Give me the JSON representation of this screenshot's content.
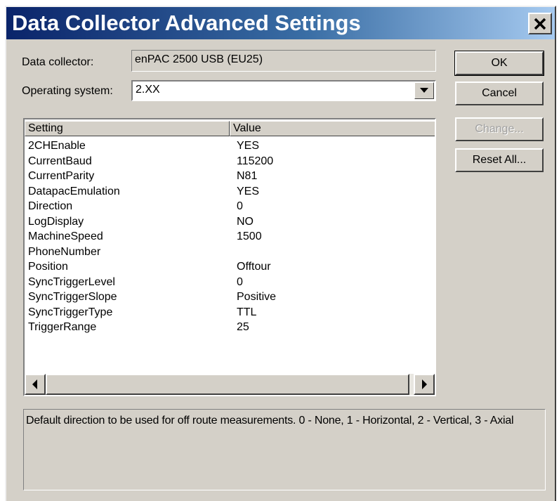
{
  "window": {
    "title": "Data Collector Advanced Settings",
    "close_label": "close"
  },
  "form": {
    "data_collector_label": "Data collector:",
    "data_collector_value": "enPAC 2500 USB (EU25)",
    "os_label": "Operating system:",
    "os_value": "2.XX"
  },
  "buttons": {
    "ok": "OK",
    "cancel": "Cancel",
    "change": "Change...",
    "reset_all": "Reset All..."
  },
  "list": {
    "columns": [
      "Setting",
      "Value"
    ],
    "rows": [
      {
        "setting": "2CHEnable",
        "value": "YES"
      },
      {
        "setting": "CurrentBaud",
        "value": "115200"
      },
      {
        "setting": "CurrentParity",
        "value": "N81"
      },
      {
        "setting": "DatapacEmulation",
        "value": "YES"
      },
      {
        "setting": "Direction",
        "value": "0"
      },
      {
        "setting": "LogDisplay",
        "value": "NO"
      },
      {
        "setting": "MachineSpeed",
        "value": "1500"
      },
      {
        "setting": "PhoneNumber",
        "value": ""
      },
      {
        "setting": "Position",
        "value": "Offtour"
      },
      {
        "setting": "SyncTriggerLevel",
        "value": "0"
      },
      {
        "setting": "SyncTriggerSlope",
        "value": "Positive"
      },
      {
        "setting": "SyncTriggerType",
        "value": "TTL"
      },
      {
        "setting": "TriggerRange",
        "value": "25"
      }
    ]
  },
  "description": "Default direction to be used for off route measurements.  0 - None, 1 - Horizontal, 2 - Vertical, 3 - Axial",
  "icons": {
    "close": "close-icon",
    "dropdown": "chevron-down-icon",
    "scroll_left": "triangle-left-icon",
    "scroll_right": "triangle-right-icon"
  }
}
